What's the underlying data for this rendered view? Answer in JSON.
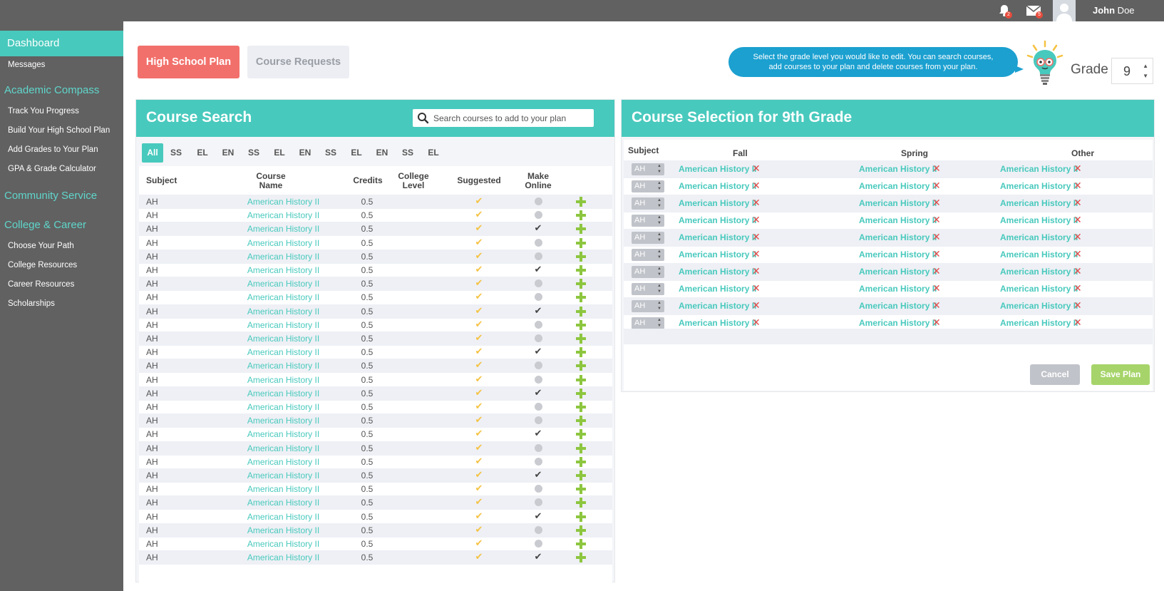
{
  "topbar": {
    "notifications_count": "2",
    "messages_count": "5",
    "user_first": "John",
    "user_last": " Doe"
  },
  "sidebar": {
    "active": "Dashboard",
    "messages": "Messages",
    "section_academic": "Academic Compass",
    "academic_items": [
      "Track You Progress",
      "Build Your High School Plan",
      "Add Grades to Your Plan",
      "GPA & Grade Calculator"
    ],
    "section_community": "Community Service",
    "section_college": "College & Career",
    "college_items": [
      "Choose Your Path",
      "College Resources",
      "Career Resources",
      "Scholarships"
    ]
  },
  "tabs": {
    "plan": "High School Plan",
    "requests": "Course Requests"
  },
  "help": {
    "line1": "Select the grade level you would like to edit. You can search courses,",
    "line2": "add courses to your plan and delete courses from your plan."
  },
  "grade": {
    "label": "Grade",
    "value": "9"
  },
  "search_panel": {
    "title": "Course Search",
    "search_placeholder": "Search courses to add to your plan",
    "filters": [
      "All",
      "SS",
      "EL",
      "EN",
      "SS",
      "EL",
      "EN",
      "SS",
      "EL",
      "EN",
      "SS",
      "EL"
    ],
    "headers": {
      "subject": "Subject",
      "name_1": "Course",
      "name_2": "Name",
      "credits": "Credits",
      "level_1": "College",
      "level_2": "Level",
      "suggested": "Suggested",
      "online_1": "Make",
      "online_2": "Online"
    },
    "rows": [
      {
        "subject": "AH",
        "name": "American History II",
        "credits": "0.5",
        "online": false
      },
      {
        "subject": "AH",
        "name": "American History II",
        "credits": "0.5",
        "online": false
      },
      {
        "subject": "AH",
        "name": "American History II",
        "credits": "0.5",
        "online": true
      },
      {
        "subject": "AH",
        "name": "American History II",
        "credits": "0.5",
        "online": false
      },
      {
        "subject": "AH",
        "name": "American History II",
        "credits": "0.5",
        "online": false
      },
      {
        "subject": "AH",
        "name": "American History II",
        "credits": "0.5",
        "online": true
      },
      {
        "subject": "AH",
        "name": "American History II",
        "credits": "0.5",
        "online": false
      },
      {
        "subject": "AH",
        "name": "American History II",
        "credits": "0.5",
        "online": false
      },
      {
        "subject": "AH",
        "name": "American History II",
        "credits": "0.5",
        "online": true
      },
      {
        "subject": "AH",
        "name": "American History II",
        "credits": "0.5",
        "online": false
      },
      {
        "subject": "AH",
        "name": "American History II",
        "credits": "0.5",
        "online": false
      },
      {
        "subject": "AH",
        "name": "American History II",
        "credits": "0.5",
        "online": true
      },
      {
        "subject": "AH",
        "name": "American History II",
        "credits": "0.5",
        "online": false
      },
      {
        "subject": "AH",
        "name": "American History II",
        "credits": "0.5",
        "online": false
      },
      {
        "subject": "AH",
        "name": "American History II",
        "credits": "0.5",
        "online": true
      },
      {
        "subject": "AH",
        "name": "American History II",
        "credits": "0.5",
        "online": false
      },
      {
        "subject": "AH",
        "name": "American History II",
        "credits": "0.5",
        "online": false
      },
      {
        "subject": "AH",
        "name": "American History II",
        "credits": "0.5",
        "online": true
      },
      {
        "subject": "AH",
        "name": "American History II",
        "credits": "0.5",
        "online": false
      },
      {
        "subject": "AH",
        "name": "American History II",
        "credits": "0.5",
        "online": false
      },
      {
        "subject": "AH",
        "name": "American History II",
        "credits": "0.5",
        "online": true
      },
      {
        "subject": "AH",
        "name": "American History II",
        "credits": "0.5",
        "online": false
      },
      {
        "subject": "AH",
        "name": "American History II",
        "credits": "0.5",
        "online": false
      },
      {
        "subject": "AH",
        "name": "American History II",
        "credits": "0.5",
        "online": true
      },
      {
        "subject": "AH",
        "name": "American History II",
        "credits": "0.5",
        "online": false
      },
      {
        "subject": "AH",
        "name": "American History II",
        "credits": "0.5",
        "online": false
      },
      {
        "subject": "AH",
        "name": "American History II",
        "credits": "0.5",
        "online": true
      }
    ]
  },
  "selection_panel": {
    "title": "Course Selection for 9th Grade",
    "headers": {
      "subject": "Subject",
      "fall": "Fall",
      "spring": "Spring",
      "other": "Other"
    },
    "rows": [
      {
        "subject": "AH",
        "fall": "American History II",
        "spring": "American History II",
        "other": "American History II"
      },
      {
        "subject": "AH",
        "fall": "American History II",
        "spring": "American History II",
        "other": "American History II"
      },
      {
        "subject": "AH",
        "fall": "American History II",
        "spring": "American History II",
        "other": "American History II"
      },
      {
        "subject": "AH",
        "fall": "American History II",
        "spring": "American History II",
        "other": "American History II"
      },
      {
        "subject": "AH",
        "fall": "American History II",
        "spring": "American History II",
        "other": "American History II"
      },
      {
        "subject": "AH",
        "fall": "American History II",
        "spring": "American History II",
        "other": "American History II"
      },
      {
        "subject": "AH",
        "fall": "American History II",
        "spring": "American History II",
        "other": "American History II"
      },
      {
        "subject": "AH",
        "fall": "American History II",
        "spring": "American History II",
        "other": "American History II"
      },
      {
        "subject": "AH",
        "fall": "American History II",
        "spring": "American History II",
        "other": "American History II"
      },
      {
        "subject": "AH",
        "fall": "American History II",
        "spring": "American History II",
        "other": "American History II"
      }
    ],
    "cancel": "Cancel",
    "save": "Save Plan"
  },
  "colors": {
    "accent": "#48c9bd",
    "plan_tab": "#f2706b",
    "help": "#1ba0d0",
    "remove": "#e54b4b",
    "add": "#8dc63f",
    "suggested": "#f5c242"
  },
  "icons": {
    "search": "search-icon",
    "add": "plus-icon",
    "remove": "x-icon",
    "suggested": "check-icon",
    "bell": "bell-icon",
    "mail": "envelope-icon"
  }
}
